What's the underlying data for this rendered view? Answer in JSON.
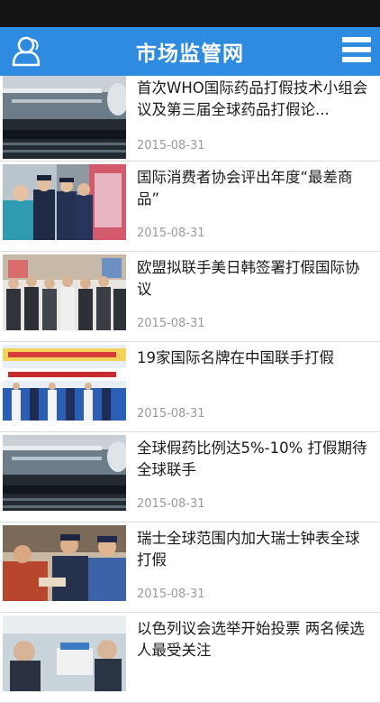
{
  "app": {
    "title": "市场监管网"
  },
  "colors": {
    "header": "#2f8be0",
    "status_bar": "#141414",
    "date": "#9a9a9a",
    "divider": "#dcdcdc"
  },
  "header": {
    "left_icon": "user-icon",
    "right_icon": "menu-icon"
  },
  "news": [
    {
      "title": "首次WHO国际药品打假技术小组会议及第三届全球药品打假论...",
      "date": "2015-08-31",
      "thumb": "harbor-scene"
    },
    {
      "title": "国际消费者协会评出年度“最差商品”",
      "date": "2015-08-31",
      "thumb": "officers-inspecting-store"
    },
    {
      "title": "欧盟拟联手美日韩签署打假国际协议",
      "date": "2015-08-31",
      "thumb": "officials-group-photo"
    },
    {
      "title": "19家国际名牌在中国联手打假",
      "date": "2015-08-31",
      "thumb": "event-banner-crowd"
    },
    {
      "title": "全球假药比例达5%-10% 打假期待全球联手",
      "date": "2015-08-31",
      "thumb": "harbor-scene"
    },
    {
      "title": "瑞士全球范围内加大瑞士钟表全球打假",
      "date": "2015-08-31",
      "thumb": "officers-checking-goods"
    },
    {
      "title": "以色列议会选举开始投票 两名候选人最受关注",
      "date": "",
      "thumb": "voting-scene"
    }
  ]
}
